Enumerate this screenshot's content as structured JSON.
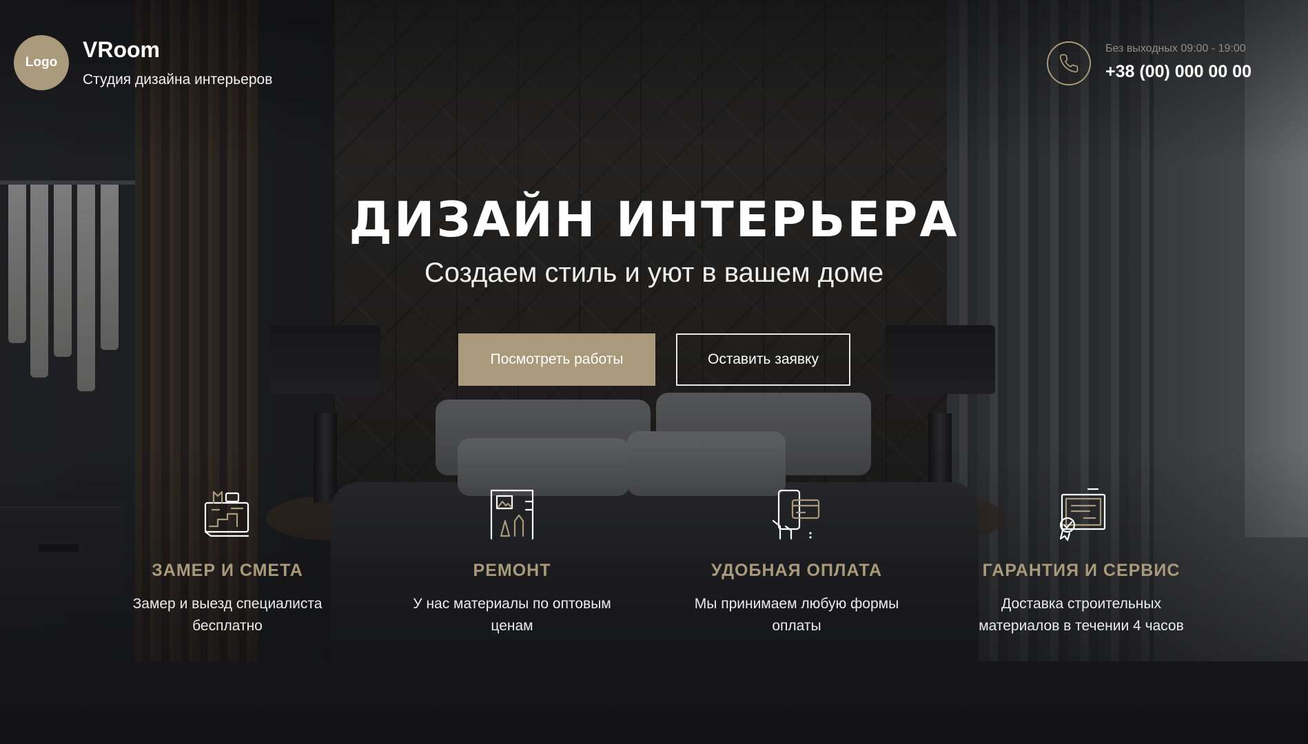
{
  "header": {
    "logo_label": "Logo",
    "brand_name": "VRoom",
    "brand_tagline": "Студия дизайна интерьеров",
    "hours": "Без выходных 09:00 - 19:00",
    "phone": "+38 (00) 000 00 00"
  },
  "hero": {
    "title": "ДИЗАЙН ИНТЕРЬЕРА",
    "subtitle": "Создаем стиль и уют в вашем доме",
    "primary_button": "Посмотреть работы",
    "secondary_button": "Оставить заявку"
  },
  "features": [
    {
      "icon": "blueprint-icon",
      "title": "ЗАМЕР И СМЕТА",
      "text_line1": "Замер и выезд специалиста",
      "text_line2": "бесплатно"
    },
    {
      "icon": "design-tools-icon",
      "title": "РЕМОНТ",
      "text_line1": "У нас материалы по оптовым",
      "text_line2": "ценам"
    },
    {
      "icon": "card-payment-icon",
      "title": "УДОБНАЯ ОПЛАТА",
      "text_line1": "Мы принимаем любую формы",
      "text_line2": "оплаты"
    },
    {
      "icon": "certificate-icon",
      "title": "ГАРАНТИЯ И СЕРВИС",
      "text_line1": "Доставка строительных",
      "text_line2": "материалов в течении 4 часов"
    }
  ],
  "colors": {
    "accent": "#a99a7b",
    "text": "#ffffff",
    "muted": "#8f8e88"
  }
}
